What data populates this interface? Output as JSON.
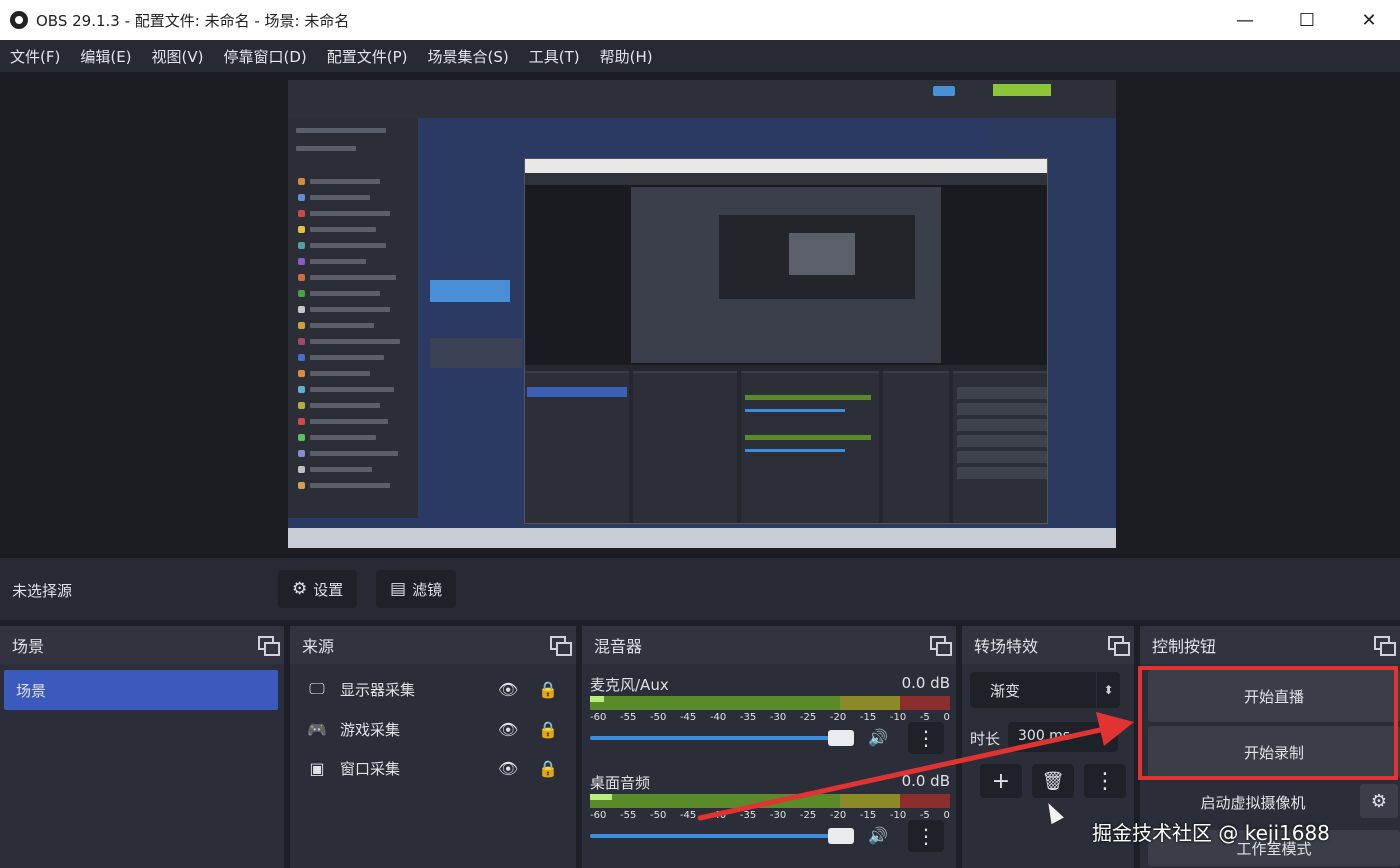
{
  "window": {
    "title": "OBS 29.1.3 - 配置文件: 未命名 - 场景: 未命名",
    "minimize_glyph": "—",
    "maximize_glyph": "☐",
    "close_glyph": "✕"
  },
  "menu": [
    "文件(F)",
    "编辑(E)",
    "视图(V)",
    "停靠窗口(D)",
    "配置文件(P)",
    "场景集合(S)",
    "工具(T)",
    "帮助(H)"
  ],
  "toolbar": {
    "no_source_label": "未选择源",
    "properties_label": "设置",
    "properties_icon": "gear-icon",
    "filters_label": "滤镜",
    "filters_icon": "filter-icon"
  },
  "scenes": {
    "header": "场景",
    "items": [
      "场景"
    ]
  },
  "sources": {
    "header": "来源",
    "items": [
      {
        "label": "显示器采集",
        "icon": "monitor-icon"
      },
      {
        "label": "游戏采集",
        "icon": "gamepad-icon"
      },
      {
        "label": "窗口采集",
        "icon": "window-icon"
      }
    ]
  },
  "mixer": {
    "header": "混音器",
    "tracks": [
      {
        "name": "麦克风/Aux",
        "db": "0.0 dB",
        "level": 0.04
      },
      {
        "name": "桌面音频",
        "db": "0.0 dB",
        "level": 0.06
      }
    ],
    "ticks": [
      "-60",
      "-55",
      "-50",
      "-45",
      "-40",
      "-35",
      "-30",
      "-25",
      "-20",
      "-15",
      "-10",
      "-5",
      "0"
    ]
  },
  "transitions": {
    "header": "转场特效",
    "selected": "渐变",
    "duration_label": "时长",
    "duration_value": "300 ms",
    "add_glyph": "+",
    "remove_glyph": "🗑",
    "more_glyph": "⋮"
  },
  "controls": {
    "header": "控制按钮",
    "start_streaming": "开始直播",
    "start_recording": "开始录制",
    "start_virtualcam": "启动虚拟摄像机",
    "studio_mode": "工作室模式",
    "highlight_color": "#e23333"
  },
  "watermark": "掘金技术社区 @ keji1688",
  "colors": {
    "accent": "#3a5bbd",
    "meter_green": "#5a8a2a",
    "meter_yellow": "#8a8a28",
    "meter_red": "#8a2e2e",
    "slider_blue": "#3b8fe0",
    "arrow_red": "#e23333"
  }
}
